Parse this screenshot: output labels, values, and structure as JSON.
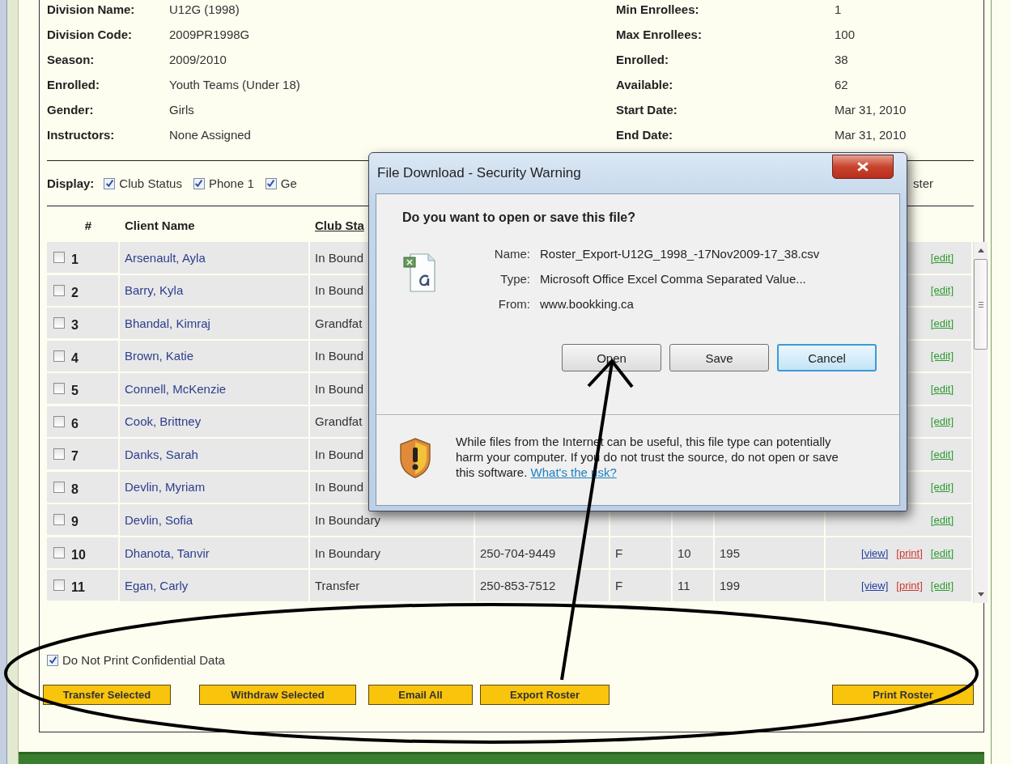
{
  "division": {
    "left": [
      {
        "label": "Division Name:",
        "value": "U12G (1998)"
      },
      {
        "label": "Division Code:",
        "value": "2009PR1998G"
      },
      {
        "label": "Season:",
        "value": "2009/2010"
      },
      {
        "label": "Enrolled:",
        "value": "Youth Teams (Under 18)"
      },
      {
        "label": "Gender:",
        "value": "Girls"
      },
      {
        "label": "Instructors:",
        "value": "None Assigned"
      }
    ],
    "right": [
      {
        "label": "Min Enrollees:",
        "value": "1"
      },
      {
        "label": "Max Enrollees:",
        "value": "100"
      },
      {
        "label": "Enrolled:",
        "value": "38"
      },
      {
        "label": "Available:",
        "value": "62"
      },
      {
        "label": "Start Date:",
        "value": "Mar 31, 2010"
      },
      {
        "label": "End Date:",
        "value": "Mar 31, 2010"
      }
    ]
  },
  "display": {
    "label": "Display:",
    "options": [
      {
        "label": "Club Status",
        "checked": true
      },
      {
        "label": "Phone 1",
        "checked": true
      },
      {
        "label": "Ge",
        "checked": true
      }
    ],
    "trailing": "ster"
  },
  "table": {
    "columns": [
      {
        "label": "#",
        "sortable": false
      },
      {
        "label": "Client Name",
        "sortable": false
      },
      {
        "label": "Club Sta",
        "sortable": true
      }
    ],
    "rows": [
      {
        "checked": false,
        "num": "1",
        "name": "Arsenault, Ayla",
        "status": "In Bound",
        "edit": "[edit]"
      },
      {
        "checked": false,
        "num": "2",
        "name": "Barry, Kyla",
        "status": "In Bound",
        "edit": "[edit]"
      },
      {
        "checked": false,
        "num": "3",
        "name": "Bhandal, Kimraj",
        "status": "Grandfat",
        "edit": "[edit]"
      },
      {
        "checked": false,
        "num": "4",
        "name": "Brown, Katie",
        "status": "In Bound",
        "edit": "[edit]"
      },
      {
        "checked": false,
        "num": "5",
        "name": "Connell, McKenzie",
        "status": "In Bound",
        "edit": "[edit]"
      },
      {
        "checked": false,
        "num": "6",
        "name": "Cook, Brittney",
        "status": "Grandfat",
        "edit": "[edit]"
      },
      {
        "checked": false,
        "num": "7",
        "name": "Danks, Sarah",
        "status": "In Bound",
        "edit": "[edit]"
      },
      {
        "checked": false,
        "num": "8",
        "name": "Devlin, Myriam",
        "status": "In Bound",
        "edit": "[edit]"
      },
      {
        "checked": false,
        "num": "9",
        "name": "Devlin, Sofia",
        "status": "In Boundary",
        "edit": "[edit]"
      },
      {
        "checked": false,
        "num": "10",
        "name": "Dhanota, Tanvir",
        "status": "In Boundary",
        "phone": "250-704-9449",
        "gender": "F",
        "column_6": "10",
        "column_7": "195",
        "view": "[view]",
        "print": "[print]",
        "edit": "[edit]"
      },
      {
        "checked": false,
        "num": "11",
        "name": "Egan, Carly",
        "status": "Transfer",
        "phone": "250-853-7512",
        "gender": "F",
        "column_6": "11",
        "column_7": "199",
        "view": "[view]",
        "print": "[print]",
        "edit": "[edit]"
      }
    ]
  },
  "confidential": {
    "label": "Do Not Print Confidential Data",
    "checked": true
  },
  "buttons": [
    "Transfer Selected",
    "Withdraw Selected",
    "Email All",
    "Export Roster",
    "Print Roster"
  ],
  "dialog": {
    "title": "File Download - Security Warning",
    "question": "Do you want to open or save this file?",
    "fields": [
      {
        "label": "Name:",
        "value": "Roster_Export-U12G_1998_-17Nov2009-17_38.csv"
      },
      {
        "label": "Type:",
        "value": "Microsoft Office Excel Comma Separated Value..."
      },
      {
        "label": "From:",
        "value": "www.bookking.ca"
      }
    ],
    "buttons": [
      {
        "label": "Open",
        "focused": false
      },
      {
        "label": "Save",
        "focused": false
      },
      {
        "label": "Cancel",
        "focused": true
      }
    ],
    "warning": "While files from the Internet can be useful, this file type can potentially harm your computer. If you do not trust the source, do not open or save this software.",
    "warning_link": "What's the risk?"
  }
}
